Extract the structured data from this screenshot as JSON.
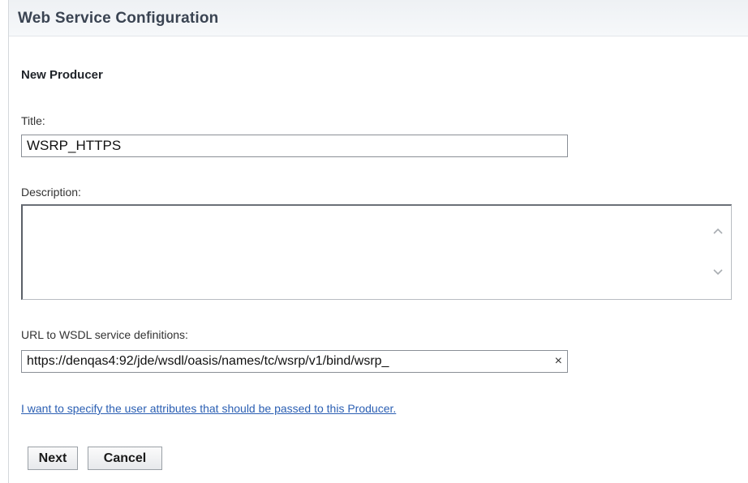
{
  "header": {
    "title": "Web Service Configuration"
  },
  "form": {
    "section_title": "New Producer",
    "title_label": "Title:",
    "title_value": "WSRP_HTTPS",
    "description_label": "Description:",
    "description_value": "",
    "url_label": "URL to WSDL service definitions:",
    "url_value": "https://denqas4:92/jde/wsdl/oasis/names/tc/wsrp/v1/bind/wsrp_",
    "clear_glyph": "×",
    "user_attributes_link": "I want to specify the user attributes that should be passed to this Producer."
  },
  "buttons": {
    "next": "Next",
    "cancel": "Cancel"
  },
  "icons": {
    "scroll_up": "chevron-up-icon",
    "scroll_down": "chevron-down-icon",
    "clear": "clear-icon"
  },
  "colors": {
    "link": "#2b5fb3",
    "header_text": "#3a4452"
  }
}
